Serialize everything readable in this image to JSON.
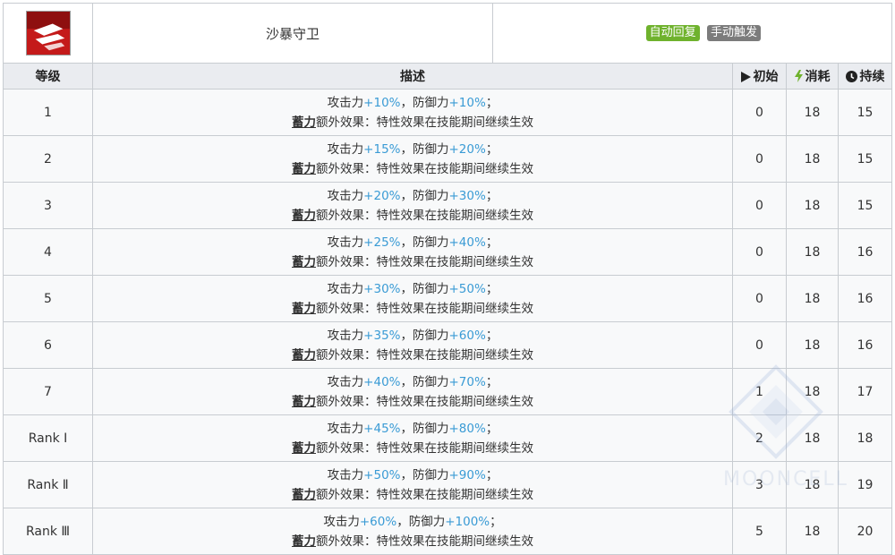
{
  "skill": {
    "name": "沙暴守卫",
    "tags": [
      "自动回复",
      "手动触发"
    ],
    "icon": "sandstorm-guard-skill-icon"
  },
  "headers": {
    "level": "等级",
    "description": "描述",
    "initial": "初始",
    "cost": "消耗",
    "duration": "持续"
  },
  "colors": {
    "tag_auto": "#6fb22d",
    "tag_manual": "#7c7c7c",
    "percent_value": "#3a9bd5",
    "header_bg": "#eaecf0",
    "row_bg": "#f8f9fa"
  },
  "desc_labels": {
    "atk": "攻击力",
    "comma": "，",
    "def": "防御力",
    "semi": "；",
    "keyword": "蓄力",
    "extra": "额外效果：特性效果在技能期间继续生效"
  },
  "rows": [
    {
      "level": "1",
      "atk": "+10%",
      "def": "+10%",
      "initial": "0",
      "cost": "18",
      "duration": "15"
    },
    {
      "level": "2",
      "atk": "+15%",
      "def": "+20%",
      "initial": "0",
      "cost": "18",
      "duration": "15"
    },
    {
      "level": "3",
      "atk": "+20%",
      "def": "+30%",
      "initial": "0",
      "cost": "18",
      "duration": "15"
    },
    {
      "level": "4",
      "atk": "+25%",
      "def": "+40%",
      "initial": "0",
      "cost": "18",
      "duration": "16"
    },
    {
      "level": "5",
      "atk": "+30%",
      "def": "+50%",
      "initial": "0",
      "cost": "18",
      "duration": "16"
    },
    {
      "level": "6",
      "atk": "+35%",
      "def": "+60%",
      "initial": "0",
      "cost": "18",
      "duration": "16"
    },
    {
      "level": "7",
      "atk": "+40%",
      "def": "+70%",
      "initial": "1",
      "cost": "18",
      "duration": "17"
    },
    {
      "level": "Rank Ⅰ",
      "atk": "+45%",
      "def": "+80%",
      "initial": "2",
      "cost": "18",
      "duration": "18"
    },
    {
      "level": "Rank Ⅱ",
      "atk": "+50%",
      "def": "+90%",
      "initial": "3",
      "cost": "18",
      "duration": "19"
    },
    {
      "level": "Rank Ⅲ",
      "atk": "+60%",
      "def": "+100%",
      "initial": "5",
      "cost": "18",
      "duration": "20"
    }
  ],
  "watermark": "MOONCELL"
}
